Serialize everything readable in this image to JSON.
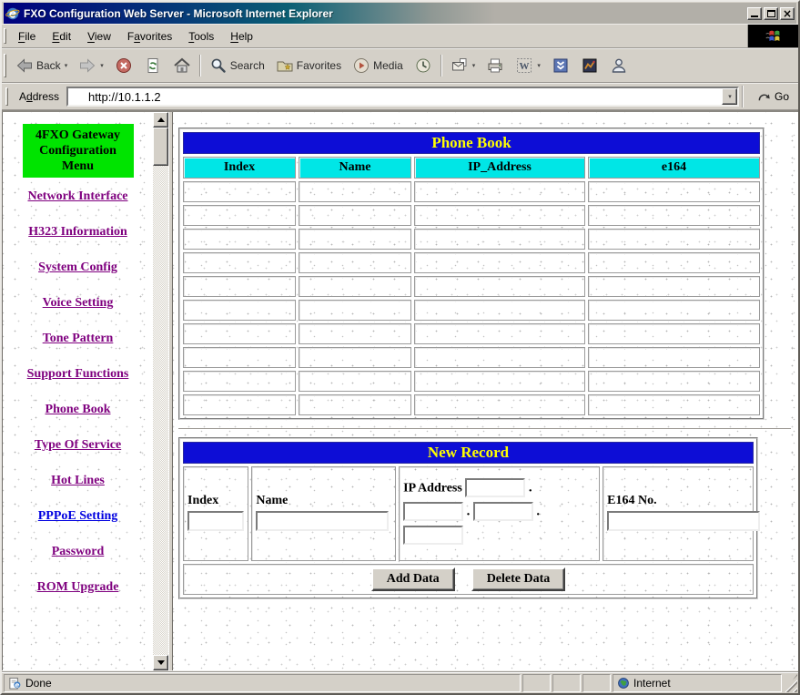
{
  "window": {
    "title": "FXO Configuration Web Server - Microsoft Internet Explorer"
  },
  "menu": {
    "items": [
      {
        "pre": "",
        "key": "F",
        "post": "ile"
      },
      {
        "pre": "",
        "key": "E",
        "post": "dit"
      },
      {
        "pre": "",
        "key": "V",
        "post": "iew"
      },
      {
        "pre": "F",
        "key": "a",
        "post": "vorites"
      },
      {
        "pre": "",
        "key": "T",
        "post": "ools"
      },
      {
        "pre": "",
        "key": "H",
        "post": "elp"
      }
    ]
  },
  "toolbar": {
    "back_label": "Back",
    "search_label": "Search",
    "favorites_label": "Favorites",
    "media_label": "Media"
  },
  "address": {
    "label_pre": "A",
    "label_key": "d",
    "label_post": "dress",
    "value": "http://10.1.1.2",
    "go_label": "Go"
  },
  "sidebar": {
    "title_lines": [
      "4FXO Gateway",
      "Configuration",
      "Menu"
    ],
    "items": [
      {
        "label": "Network Interface",
        "state": "visited"
      },
      {
        "label": "H323 Information",
        "state": "visited"
      },
      {
        "label": "System Config",
        "state": "visited"
      },
      {
        "label": "Voice Setting",
        "state": "visited"
      },
      {
        "label": "Tone Pattern",
        "state": "visited"
      },
      {
        "label": "Support Functions",
        "state": "visited"
      },
      {
        "label": "Phone Book",
        "state": "visited"
      },
      {
        "label": "Type Of Service",
        "state": "visited"
      },
      {
        "label": "Hot Lines",
        "state": "visited"
      },
      {
        "label": "PPPoE Setting",
        "state": "unvisited"
      },
      {
        "label": "Password",
        "state": "visited"
      },
      {
        "label": "ROM Upgrade",
        "state": "visited"
      }
    ]
  },
  "phone_book": {
    "title": "Phone Book",
    "columns": [
      "Index",
      "Name",
      "IP_Address",
      "e164"
    ],
    "empty_row_count": 10
  },
  "new_record": {
    "title": "New Record",
    "index_label": "Index",
    "name_label": "Name",
    "ip_label": "IP Address",
    "e164_label": "E164 No.",
    "dot": ".",
    "add_button": "Add Data",
    "delete_button": "Delete Data"
  },
  "status": {
    "done": "Done",
    "zone": "Internet"
  },
  "icons": {
    "caret": "▾",
    "close_glyph": "×"
  },
  "colors": {
    "header_blue": "#0d0dd6",
    "header_cyan": "#00e6e6",
    "menu_green": "#00e400",
    "link_visited": "#7f007f",
    "link_unvisited": "#0000e0",
    "title_yellow": "#ffff00"
  }
}
